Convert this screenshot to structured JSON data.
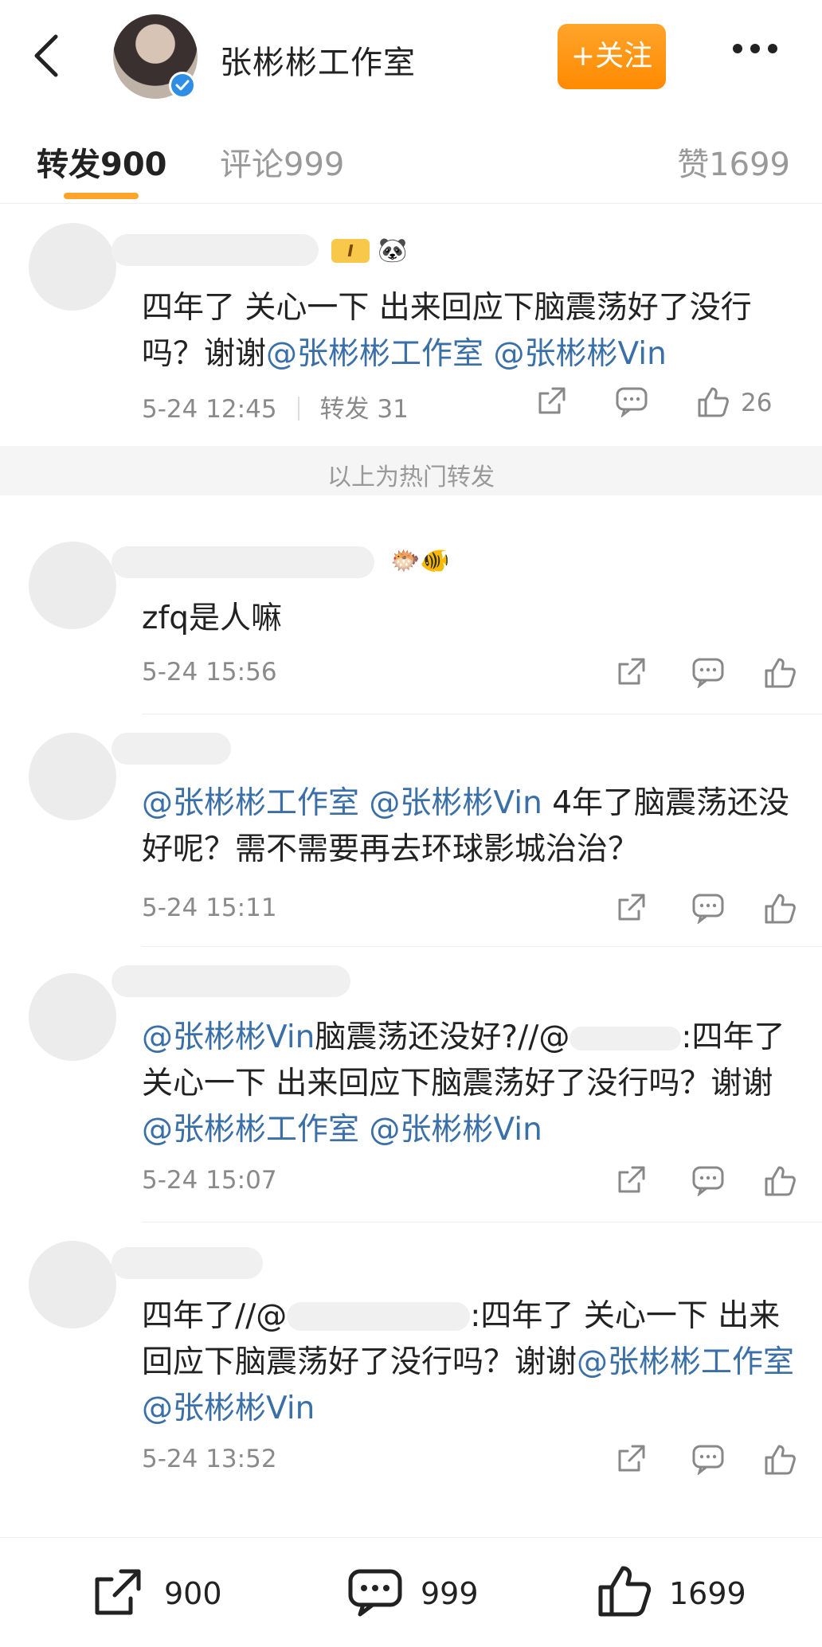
{
  "header": {
    "title": "张彬彬工作室",
    "follow_label": "+关注",
    "accent": "#ff9a1a"
  },
  "tabs": [
    {
      "label": "转发",
      "count": "900",
      "active": true
    },
    {
      "label": "评论",
      "count": "999",
      "active": false
    },
    {
      "label": "赞",
      "count": "1699",
      "active": false
    }
  ],
  "hot_item": {
    "prefix": "四年了 关心一下 出来回应下脑震荡好了没行吗？谢谢",
    "mention1": "@张彬彬工作室",
    "mention2": "@张彬彬Vin",
    "time": "5-24 12:45",
    "repost_label": "转发 31",
    "likes": "26",
    "badge": "I",
    "emoji": "🐼"
  },
  "hot_divider_label": "以上为热门转发",
  "items": [
    {
      "text": "zfq是人嘛",
      "time": "5-24 15:56",
      "emoji": "🐡🐠"
    },
    {
      "mention1": "@张彬彬工作室",
      "mention2": "@张彬彬Vin",
      "text_rest": " 4年了脑震荡还没好呢？需不需要再去环球影城治治？",
      "time": "5-24 15:11"
    },
    {
      "mention_lead": "@张彬彬Vin",
      "text_a": "脑震荡还没好?//@",
      "text_b": ":四年了 关心一下 出来回应下脑震荡好了没行吗？谢谢",
      "mention1": "@张彬彬工作室",
      "mention2": "@张彬彬Vin",
      "time": "5-24 15:07"
    },
    {
      "text_a": "四年了//@",
      "text_b": ":四年了 关心一下 出来回应下脑震荡好了没行吗？谢谢",
      "mention1": "@张彬彬工作室",
      "mention2": "@张彬彬Vin",
      "time": "5-24 13:52"
    }
  ],
  "bottom_bar": {
    "repost_count": "900",
    "comment_count": "999",
    "like_count": "1699"
  }
}
